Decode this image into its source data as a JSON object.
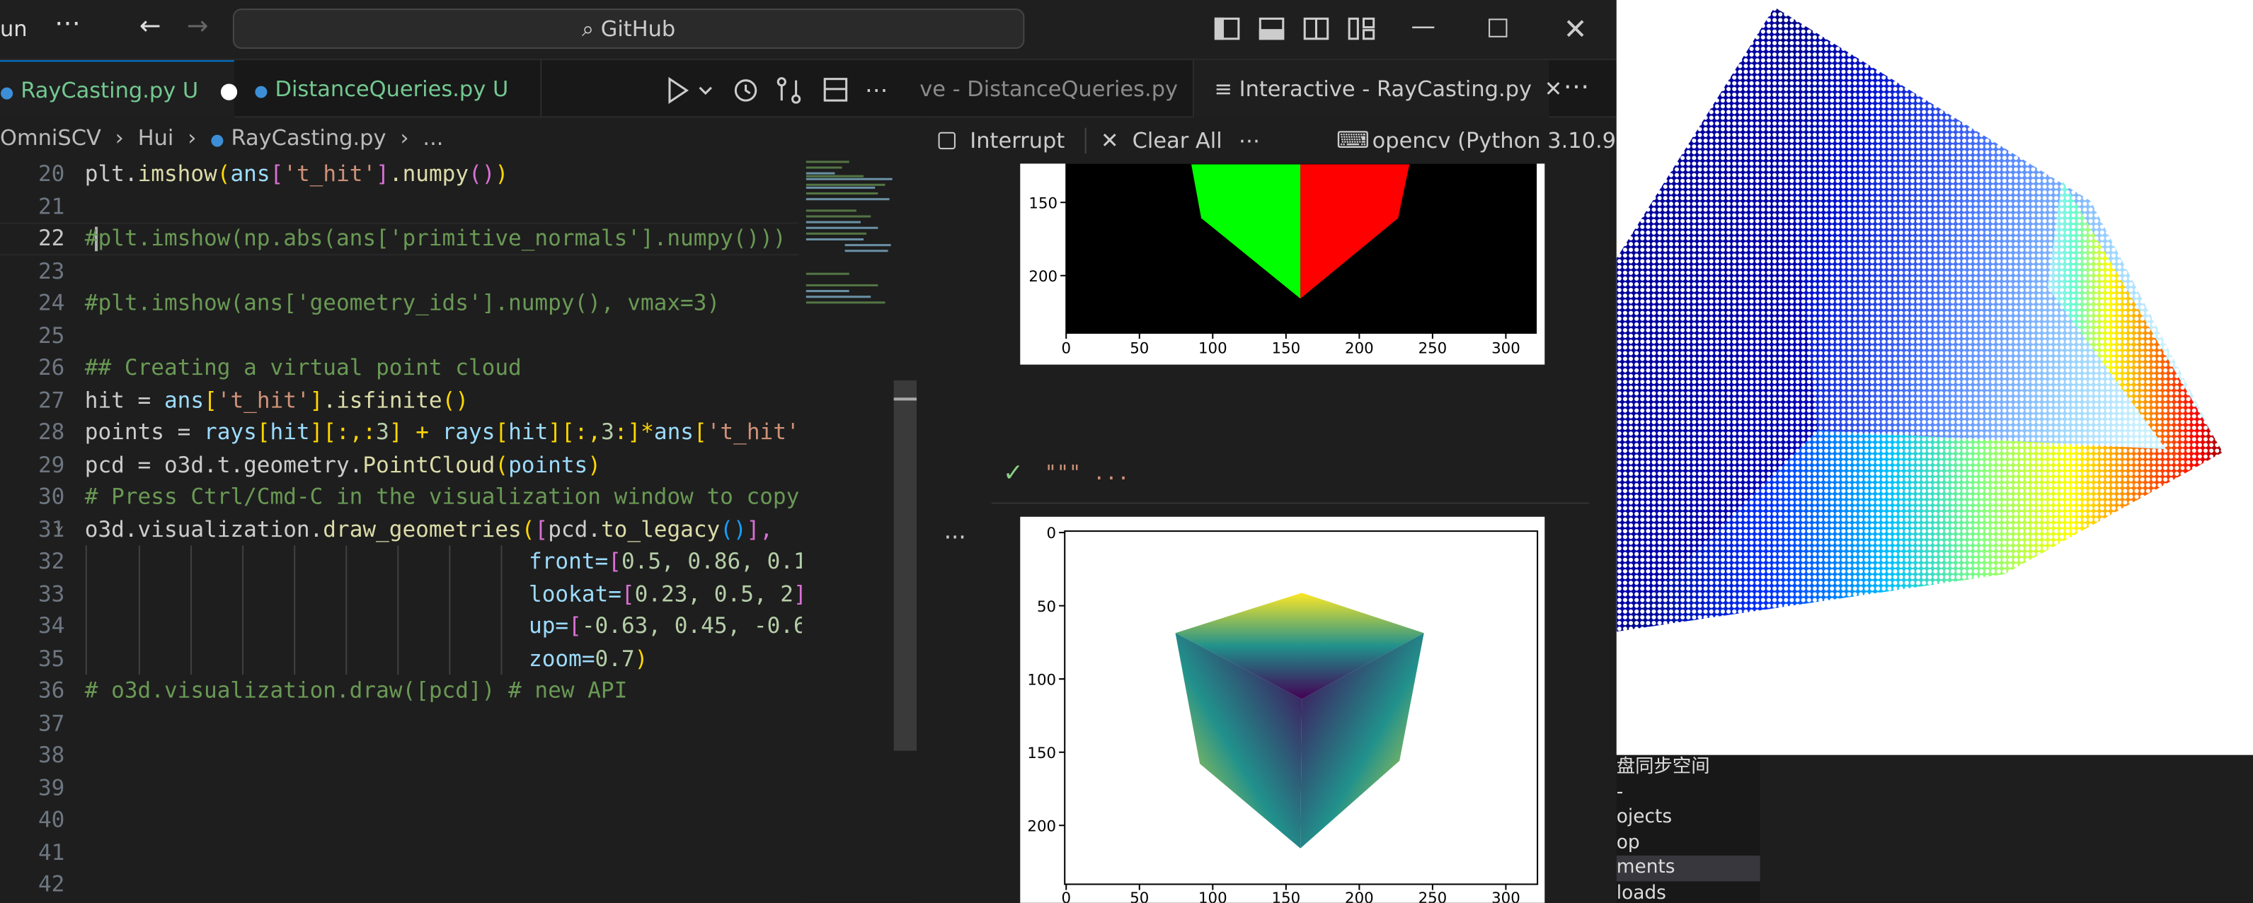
{
  "titlebar": {
    "menu_run": "un",
    "search": "GitHub"
  },
  "tabs": {
    "tab1": "RayCasting.py",
    "tab1_status": "U",
    "tab2": "DistanceQueries.py",
    "tab2_status": "U",
    "tab3": "ve - DistanceQueries.py",
    "tab4": "Interactive - RayCasting.py"
  },
  "breadcrumb": {
    "part1": "OmniSCV",
    "part2": "Hui",
    "part3": "RayCasting.py",
    "part4": "..."
  },
  "interactive": {
    "interrupt": "Interrupt",
    "clear_all": "Clear All",
    "kernel": "opencv (Python 3.10.9)",
    "cell_header": "\"\"\" ...",
    "more": "..."
  },
  "code": {
    "line_numbers": [
      "20",
      "21",
      "22",
      "23",
      "24",
      "25",
      "26",
      "27",
      "28",
      "29",
      "30",
      "31",
      "32",
      "33",
      "34",
      "35",
      "36",
      "37",
      "38",
      "39",
      "40",
      "41",
      "42"
    ],
    "l20": [
      "plt.",
      ".numpy",
      "ans",
      "'t_hit'",
      "imshow",
      "(",
      ")",
      "[",
      "]",
      "()"
    ],
    "l22": "#plt.imshow(np.abs(ans['primitive_normals'].numpy()))",
    "l24": "#plt.imshow(ans['geometry_ids'].numpy(), vmax=3)",
    "l26": "## Creating a virtual point cloud",
    "l27": [
      "hit = ",
      "ans",
      "[",
      "'t_hit'",
      "]",
      ".isfinite",
      "()"
    ],
    "l28": [
      "points = ",
      "rays",
      "[",
      "hit",
      "][:,:",
      "3",
      "] + ",
      "rays",
      "[",
      "hit",
      "][:,",
      "3",
      ":]*",
      "ans",
      "[",
      "'t_hit'",
      "]"
    ],
    "l29": [
      "pcd = o3d.t.geometry.",
      "PointCloud",
      "(",
      "points",
      ")"
    ],
    "l30": "# Press Ctrl/Cmd-C in the visualization window to copy",
    "l31": [
      "o3d.visualization.",
      "draw_geometries",
      "(",
      "[",
      "pcd.",
      "to_legacy",
      "()",
      "],"
    ],
    "l32": [
      "front=",
      "[",
      "0.5, 0.86, 0.1"
    ],
    "l33": [
      "lookat=",
      "[",
      "0.23, 0.5, 2",
      "]"
    ],
    "l34": [
      "up=",
      "[",
      "-0.63, 0.45, -0.6"
    ],
    "l35": [
      "zoom=",
      "0.7",
      ")"
    ],
    "l36": "# o3d.visualization.draw([pcd]) # new API"
  },
  "plot_top": {
    "yticks": [
      "150",
      "200"
    ],
    "xticks": [
      "0",
      "50",
      "100",
      "150",
      "200",
      "250",
      "300"
    ],
    "colors": {
      "green": "#00ff00",
      "red": "#ff0000",
      "bg": "#000000"
    }
  },
  "plot_bottom": {
    "yticks": [
      "0",
      "50",
      "100",
      "150",
      "200"
    ],
    "xticks": [
      "0",
      "50",
      "100",
      "150",
      "200",
      "250",
      "300"
    ],
    "colormap": "viridis"
  },
  "viewer": {
    "colormap": "jet",
    "background": "#ffffff"
  },
  "explorer": {
    "items": [
      "盘同步空间",
      "-",
      "ojects",
      "op",
      "ments",
      "loads"
    ]
  }
}
